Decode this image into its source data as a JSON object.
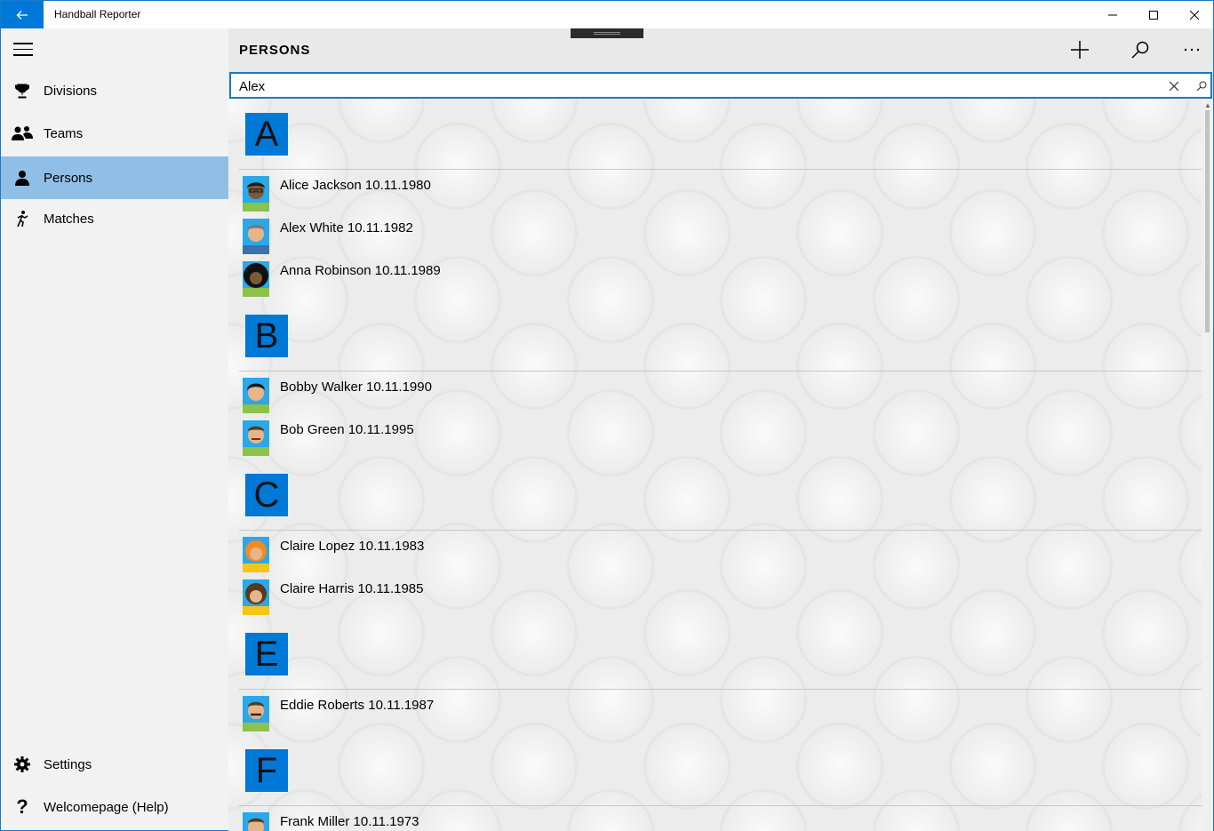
{
  "window": {
    "title": "Handball Reporter",
    "back_icon": "back-arrow-icon",
    "min_icon": "minimize-icon",
    "max_icon": "maximize-icon",
    "close_icon": "close-icon"
  },
  "sidebar": {
    "items": [
      {
        "label": "Divisions",
        "icon": "trophy-icon"
      },
      {
        "label": "Teams",
        "icon": "people-icon"
      },
      {
        "label": "Persons",
        "icon": "person-icon",
        "active": true
      },
      {
        "label": "Matches",
        "icon": "runner-icon"
      }
    ],
    "bottom_items": [
      {
        "label": "Settings",
        "icon": "gear-icon"
      },
      {
        "label": "Welcomepage (Help)",
        "icon": "question-icon"
      }
    ]
  },
  "page": {
    "title": "PERSONS",
    "commands": [
      "add-icon",
      "search-icon",
      "more-icon"
    ]
  },
  "search": {
    "value": "Alex"
  },
  "groups": [
    {
      "letter": "A",
      "persons": [
        {
          "name": "Alice Jackson",
          "date": "10.11.1980"
        },
        {
          "name": "Alex White",
          "date": "10.11.1982"
        },
        {
          "name": "Anna Robinson",
          "date": "10.11.1989"
        }
      ]
    },
    {
      "letter": "B",
      "persons": [
        {
          "name": "Bobby Walker",
          "date": "10.11.1990"
        },
        {
          "name": "Bob Green",
          "date": "10.11.1995"
        }
      ]
    },
    {
      "letter": "C",
      "persons": [
        {
          "name": "Claire Lopez",
          "date": "10.11.1983"
        },
        {
          "name": "Claire Harris",
          "date": "10.11.1985"
        }
      ]
    },
    {
      "letter": "E",
      "persons": [
        {
          "name": "Eddie Roberts",
          "date": "10.11.1987"
        }
      ]
    },
    {
      "letter": "F",
      "persons": [
        {
          "name": "Frank Miller",
          "date": "10.11.1973"
        }
      ]
    }
  ],
  "colors": {
    "accent": "#0078d7",
    "active_nav": "#8fbfe7"
  }
}
